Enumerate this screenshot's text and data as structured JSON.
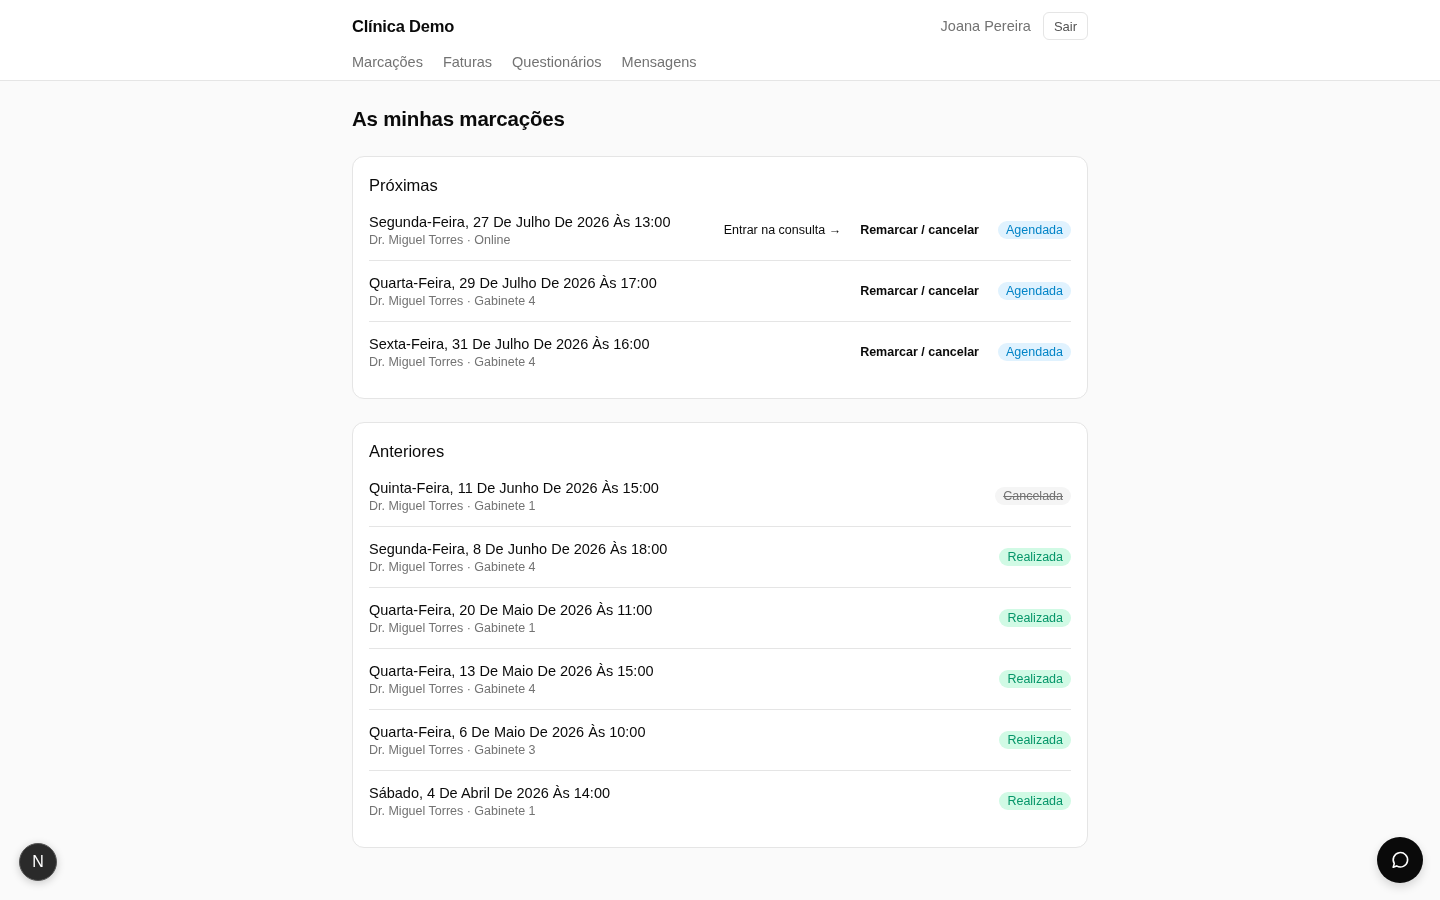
{
  "header": {
    "brand": "Clínica Demo",
    "user_name": "Joana Pereira",
    "logout_button": "Sair",
    "nav": [
      "Marcações",
      "Faturas",
      "Questionários",
      "Mensagens"
    ]
  },
  "page_title": "As minhas marcações",
  "sections": [
    {
      "title": "Próximas",
      "appointments": [
        {
          "datetime": "Segunda-Feira, 27 De Julho De 2026 Às 13:00",
          "details": "Dr. Miguel Torres · Online",
          "actions": [
            {
              "label": "Entrar na consulta →",
              "kind": "join"
            },
            {
              "label": "Remarcar / cancelar",
              "kind": "reschedule"
            }
          ],
          "status": {
            "label": "Agendada",
            "kind": "scheduled"
          }
        },
        {
          "datetime": "Quarta-Feira, 29 De Julho De 2026 Às 17:00",
          "details": "Dr. Miguel Torres · Gabinete 4",
          "actions": [
            {
              "label": "Remarcar / cancelar",
              "kind": "reschedule"
            }
          ],
          "status": {
            "label": "Agendada",
            "kind": "scheduled"
          }
        },
        {
          "datetime": "Sexta-Feira, 31 De Julho De 2026 Às 16:00",
          "details": "Dr. Miguel Torres · Gabinete 4",
          "actions": [
            {
              "label": "Remarcar / cancelar",
              "kind": "reschedule"
            }
          ],
          "status": {
            "label": "Agendada",
            "kind": "scheduled"
          }
        }
      ]
    },
    {
      "title": "Anteriores",
      "appointments": [
        {
          "datetime": "Quinta-Feira, 11 De Junho De 2026 Às 15:00",
          "details": "Dr. Miguel Torres · Gabinete 1",
          "status": {
            "label": "Cancelada",
            "kind": "cancelled"
          }
        },
        {
          "datetime": "Segunda-Feira, 8 De Junho De 2026 Às 18:00",
          "details": "Dr. Miguel Torres · Gabinete 4",
          "status": {
            "label": "Realizada",
            "kind": "completed"
          }
        },
        {
          "datetime": "Quarta-Feira, 20 De Maio De 2026 Às 11:00",
          "details": "Dr. Miguel Torres · Gabinete 1",
          "status": {
            "label": "Realizada",
            "kind": "completed"
          }
        },
        {
          "datetime": "Quarta-Feira, 13 De Maio De 2026 Às 15:00",
          "details": "Dr. Miguel Torres · Gabinete 4",
          "status": {
            "label": "Realizada",
            "kind": "completed"
          }
        },
        {
          "datetime": "Quarta-Feira, 6 De Maio De 2026 Às 10:00",
          "details": "Dr. Miguel Torres · Gabinete 3",
          "status": {
            "label": "Realizada",
            "kind": "completed"
          }
        },
        {
          "datetime": "Sábado, 4 De Abril De 2026 Às 14:00",
          "details": "Dr. Miguel Torres · Gabinete 1",
          "status": {
            "label": "Realizada",
            "kind": "completed"
          }
        }
      ]
    }
  ],
  "dev_indicator": {
    "label": "N"
  }
}
